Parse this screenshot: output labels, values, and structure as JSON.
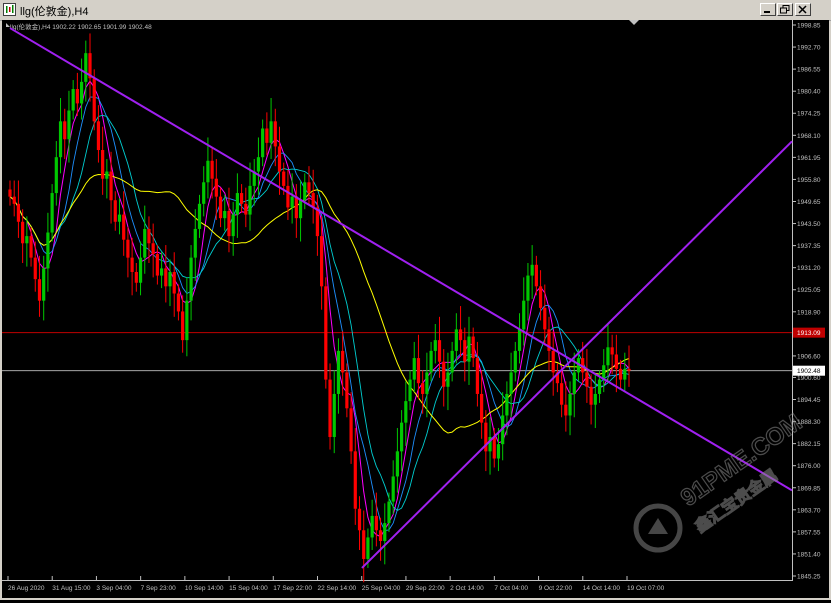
{
  "window": {
    "title": "llg(伦敦金),H4"
  },
  "info_line": {
    "symbol": "llg(伦敦金),H4",
    "open": "1902.22",
    "high": "1902.65",
    "low": "1901.99",
    "close": "1902.48"
  },
  "price_axis": {
    "ticks": [
      "1998.85",
      "1992.70",
      "1986.55",
      "1980.40",
      "1974.25",
      "1968.10",
      "1961.95",
      "1955.80",
      "1949.65",
      "1943.50",
      "1937.35",
      "1931.20",
      "1925.05",
      "1918.90",
      "1906.60",
      "1900.60",
      "1894.45",
      "1888.30",
      "1882.15",
      "1876.00",
      "1869.85",
      "1863.70",
      "1857.55",
      "1851.40",
      "1845.25"
    ],
    "red_line_label": "1913.09",
    "current_price_label": "1902.48"
  },
  "time_axis": {
    "labels": [
      "26 Aug 2020",
      "31 Aug 15:00",
      "3 Sep 04:00",
      "7 Sep 23:00",
      "10 Sep 14:00",
      "15 Sep 04:00",
      "17 Sep 22:00",
      "22 Sep 14:00",
      "25 Sep 04:00",
      "29 Sep 22:00",
      "2 Oct 14:00",
      "7 Oct 04:00",
      "9 Oct 22:00",
      "14 Oct 14:00",
      "19 Oct 07:00"
    ]
  },
  "watermark": {
    "site": "91PME.COM",
    "brand": "鑫汇宝贵金属"
  },
  "colors": {
    "background": "#000000",
    "bull": "#00c800",
    "bear": "#ff0000",
    "trendline": "#a020f0",
    "red_level": "#c00000",
    "current_line": "#c0c0c0",
    "ma_fast": "#ff00ff",
    "ma_mid1": "#1e90ff",
    "ma_mid2": "#00ced1",
    "ma_slow": "#ffff00"
  },
  "chart_data": {
    "type": "candlestick",
    "symbol": "llg",
    "timeframe": "H4",
    "ylim": [
      1845.25,
      1998.85
    ],
    "closes": [
      1951,
      1949,
      1944,
      1938,
      1940,
      1934,
      1928,
      1922,
      1931,
      1941,
      1952,
      1962,
      1972,
      1967,
      1975,
      1981,
      1977,
      1983,
      1991,
      1984,
      1972,
      1964,
      1956,
      1958,
      1950,
      1944,
      1946,
      1939,
      1934,
      1930,
      1927,
      1934,
      1942,
      1938,
      1935,
      1929,
      1931,
      1926,
      1930,
      1924,
      1919,
      1911,
      1922,
      1934,
      1942,
      1949,
      1955,
      1961,
      1956,
      1951,
      1945,
      1947,
      1940,
      1946,
      1952,
      1949,
      1946,
      1954,
      1958,
      1962,
      1970,
      1966,
      1972,
      1965,
      1958,
      1954,
      1948,
      1951,
      1945,
      1950,
      1955,
      1952,
      1948,
      1940,
      1926,
      1900,
      1884,
      1896,
      1908,
      1902,
      1892,
      1880,
      1864,
      1858,
      1850,
      1856,
      1862,
      1858,
      1855,
      1860,
      1866,
      1873,
      1880,
      1888,
      1894,
      1900,
      1906,
      1899,
      1896,
      1902,
      1908,
      1911,
      1905,
      1898,
      1902,
      1908,
      1914,
      1911,
      1905,
      1912,
      1906,
      1896,
      1888,
      1880,
      1884,
      1878,
      1882,
      1890,
      1896,
      1902,
      1908,
      1914,
      1922,
      1929,
      1932,
      1926,
      1920,
      1914,
      1908,
      1902,
      1899,
      1893,
      1890,
      1896,
      1902,
      1906,
      1902,
      1898,
      1893,
      1896,
      1900,
      1904,
      1909,
      1907,
      1903,
      1900,
      1903,
      1902.48
    ],
    "red_level": 1913.09,
    "current_price": 1902.48,
    "trendlines": [
      {
        "name": "descending",
        "from": [
          "26 Aug 2020",
          1998.0
        ],
        "to": [
          "19 Oct 07:00",
          1896.5
        ]
      },
      {
        "name": "ascending",
        "from": [
          "25 Sep 04:00",
          1847.5
        ],
        "to": [
          "19 Oct 07:00",
          1920.5
        ]
      }
    ]
  }
}
